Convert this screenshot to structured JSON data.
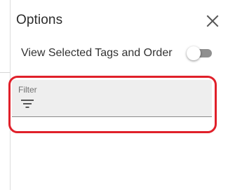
{
  "panel": {
    "title": "Options",
    "close_icon": "close-icon"
  },
  "toggle": {
    "label": "View Selected Tags and Order",
    "checked": false
  },
  "filter": {
    "label": "Filter",
    "value": "",
    "icon": "filter-list-icon"
  },
  "colors": {
    "highlight": "#e0202a",
    "field_bg": "#eeeeee",
    "switch_track_off": "#8f8f8f"
  }
}
